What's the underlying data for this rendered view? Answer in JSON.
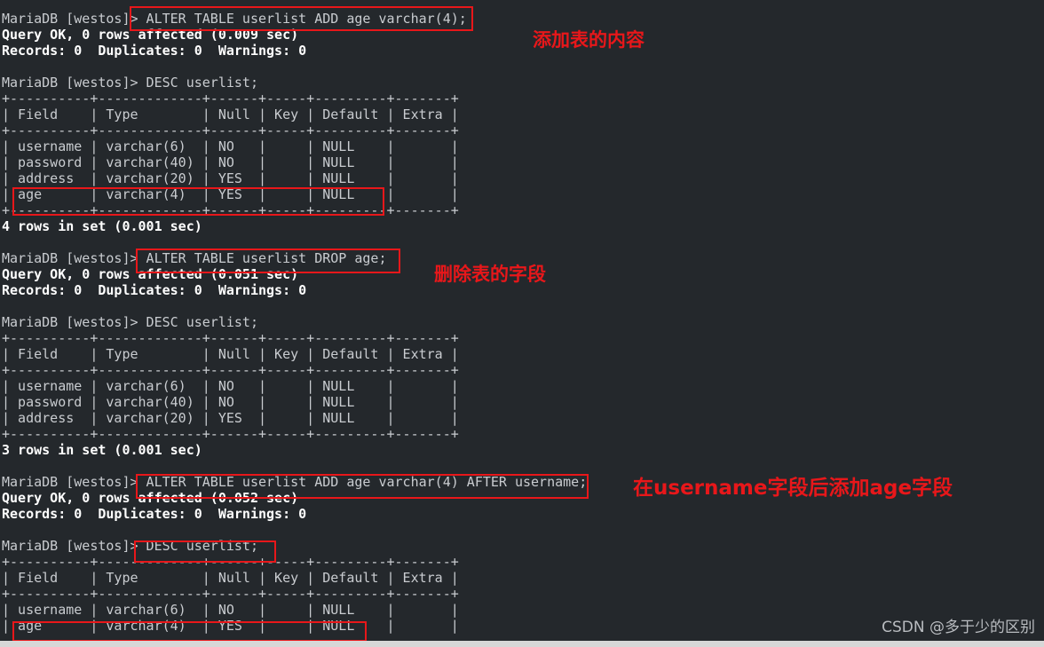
{
  "terminal": {
    "prompt": "MariaDB [westos]> ",
    "lines": [
      {
        "id": "l01",
        "text": "MariaDB [westos]> ALTER TABLE userlist ADD age varchar(4);",
        "style": "normal"
      },
      {
        "id": "l02",
        "text": "Query OK, 0 rows affected (0.009 sec)",
        "style": "bold"
      },
      {
        "id": "l03",
        "text": "Records: 0  Duplicates: 0  Warnings: 0",
        "style": "bold"
      },
      {
        "id": "l04",
        "text": "",
        "style": "normal"
      },
      {
        "id": "l05",
        "text": "MariaDB [westos]> DESC userlist;",
        "style": "normal"
      },
      {
        "id": "l06",
        "text": "+----------+-------------+------+-----+---------+-------+",
        "style": "normal"
      },
      {
        "id": "l07",
        "text": "| Field    | Type        | Null | Key | Default | Extra |",
        "style": "normal"
      },
      {
        "id": "l08",
        "text": "+----------+-------------+------+-----+---------+-------+",
        "style": "normal"
      },
      {
        "id": "l09",
        "text": "| username | varchar(6)  | NO   |     | NULL    |       |",
        "style": "normal"
      },
      {
        "id": "l10",
        "text": "| password | varchar(40) | NO   |     | NULL    |       |",
        "style": "normal"
      },
      {
        "id": "l11",
        "text": "| address  | varchar(20) | YES  |     | NULL    |       |",
        "style": "normal"
      },
      {
        "id": "l12",
        "text": "| age      | varchar(4)  | YES  |     | NULL    |       |",
        "style": "normal"
      },
      {
        "id": "l13",
        "text": "+----------+-------------+------+-----+---------+-------+",
        "style": "normal"
      },
      {
        "id": "l14",
        "text": "4 rows in set (0.001 sec)",
        "style": "bold"
      },
      {
        "id": "l15",
        "text": "",
        "style": "normal"
      },
      {
        "id": "l16",
        "text": "MariaDB [westos]> ALTER TABLE userlist DROP age;",
        "style": "normal"
      },
      {
        "id": "l17",
        "text": "Query OK, 0 rows affected (0.051 sec)",
        "style": "bold"
      },
      {
        "id": "l18",
        "text": "Records: 0  Duplicates: 0  Warnings: 0",
        "style": "bold"
      },
      {
        "id": "l19",
        "text": "",
        "style": "normal"
      },
      {
        "id": "l20",
        "text": "MariaDB [westos]> DESC userlist;",
        "style": "normal"
      },
      {
        "id": "l21",
        "text": "+----------+-------------+------+-----+---------+-------+",
        "style": "normal"
      },
      {
        "id": "l22",
        "text": "| Field    | Type        | Null | Key | Default | Extra |",
        "style": "normal"
      },
      {
        "id": "l23",
        "text": "+----------+-------------+------+-----+---------+-------+",
        "style": "normal"
      },
      {
        "id": "l24",
        "text": "| username | varchar(6)  | NO   |     | NULL    |       |",
        "style": "normal"
      },
      {
        "id": "l25",
        "text": "| password | varchar(40) | NO   |     | NULL    |       |",
        "style": "normal"
      },
      {
        "id": "l26",
        "text": "| address  | varchar(20) | YES  |     | NULL    |       |",
        "style": "normal"
      },
      {
        "id": "l27",
        "text": "+----------+-------------+------+-----+---------+-------+",
        "style": "normal"
      },
      {
        "id": "l28",
        "text": "3 rows in set (0.001 sec)",
        "style": "bold"
      },
      {
        "id": "l29",
        "text": "",
        "style": "normal"
      },
      {
        "id": "l30",
        "text": "MariaDB [westos]> ALTER TABLE userlist ADD age varchar(4) AFTER username;",
        "style": "normal"
      },
      {
        "id": "l31",
        "text": "Query OK, 0 rows affected (0.052 sec)",
        "style": "bold"
      },
      {
        "id": "l32",
        "text": "Records: 0  Duplicates: 0  Warnings: 0",
        "style": "bold"
      },
      {
        "id": "l33",
        "text": "",
        "style": "normal"
      },
      {
        "id": "l34",
        "text": "MariaDB [westos]> DESC userlist;",
        "style": "normal"
      },
      {
        "id": "l35",
        "text": "+----------+-------------+------+-----+---------+-------+",
        "style": "normal"
      },
      {
        "id": "l36",
        "text": "| Field    | Type        | Null | Key | Default | Extra |",
        "style": "normal"
      },
      {
        "id": "l37",
        "text": "+----------+-------------+------+-----+---------+-------+",
        "style": "normal"
      },
      {
        "id": "l38",
        "text": "| username | varchar(6)  | NO   |     | NULL    |       |",
        "style": "normal"
      },
      {
        "id": "l39",
        "text": "| age      | varchar(4)  | YES  |     | NULL    |       |",
        "style": "normal"
      }
    ]
  },
  "commands": {
    "add_column": "ALTER TABLE userlist ADD age varchar(4);",
    "drop_column": "ALTER TABLE userlist DROP age;",
    "add_after": "ALTER TABLE userlist ADD age varchar(4) AFTER username;",
    "desc": "DESC userlist;"
  },
  "tables": {
    "headers": [
      "Field",
      "Type",
      "Null",
      "Key",
      "Default",
      "Extra"
    ],
    "first": {
      "rows": [
        [
          "username",
          "varchar(6)",
          "NO",
          "",
          "NULL",
          ""
        ],
        [
          "password",
          "varchar(40)",
          "NO",
          "",
          "NULL",
          ""
        ],
        [
          "address",
          "varchar(20)",
          "YES",
          "",
          "NULL",
          ""
        ],
        [
          "age",
          "varchar(4)",
          "YES",
          "",
          "NULL",
          ""
        ]
      ],
      "footer": "4 rows in set (0.001 sec)"
    },
    "second": {
      "rows": [
        [
          "username",
          "varchar(6)",
          "NO",
          "",
          "NULL",
          ""
        ],
        [
          "password",
          "varchar(40)",
          "NO",
          "",
          "NULL",
          ""
        ],
        [
          "address",
          "varchar(20)",
          "YES",
          "",
          "NULL",
          ""
        ]
      ],
      "footer": "3 rows in set (0.001 sec)"
    },
    "third": {
      "rows": [
        [
          "username",
          "varchar(6)",
          "NO",
          "",
          "NULL",
          ""
        ],
        [
          "age",
          "varchar(4)",
          "YES",
          "",
          "NULL",
          ""
        ]
      ],
      "footer": ""
    }
  },
  "annotations": [
    {
      "id": "a1",
      "text": "添加表的内容"
    },
    {
      "id": "a2",
      "text": "删除表的字段"
    },
    {
      "id": "a3",
      "text": "在username字段后添加age字段"
    }
  ],
  "watermark": "CSDN @多于少的区别",
  "colors": {
    "background": "#24282c",
    "text": "#c9ccd0",
    "bold_text": "#ffffff",
    "annotation_red": "#e8171a",
    "watermark": "#b9bcc0"
  }
}
